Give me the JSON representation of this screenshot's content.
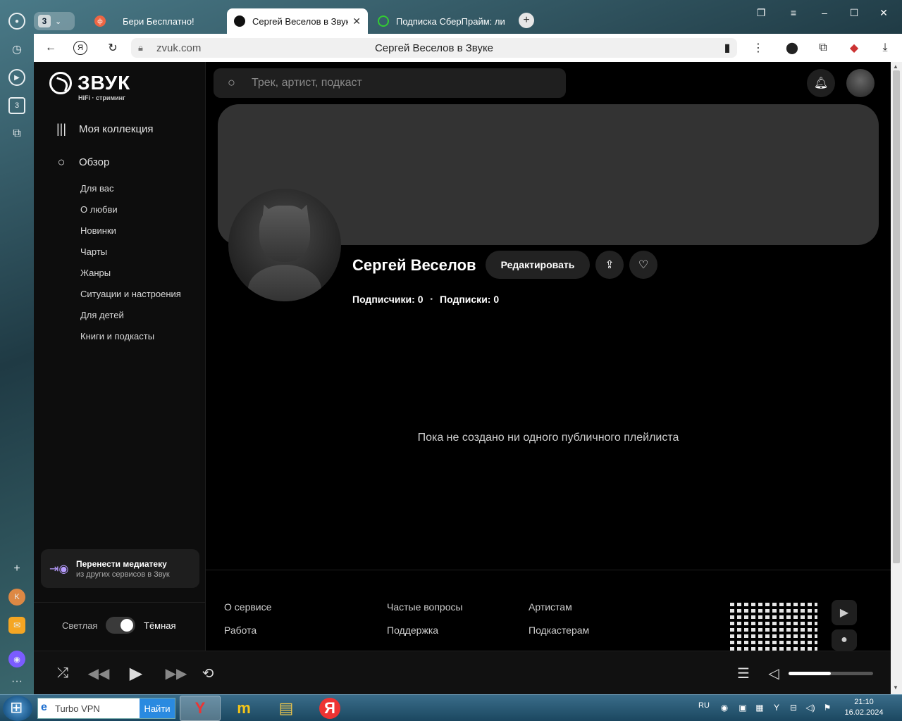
{
  "browser": {
    "tab_group_count": "3",
    "tabs": [
      {
        "title": "Бери Бесплатно!"
      },
      {
        "title": "Сергей Веселов в Звуке"
      },
      {
        "title": "Подписка СберПрайм: ли"
      }
    ],
    "url_host": "zvuk.com",
    "page_title": "Сергей Веселов в Звуке",
    "sidebar_badge": "3"
  },
  "app": {
    "logo_text": "ЗВУК",
    "logo_sub": "HiFi · стриминг",
    "nav_main": [
      {
        "label": "Моя коллекция"
      },
      {
        "label": "Обзор"
      }
    ],
    "nav_sub": [
      "Для вас",
      "О любви",
      "Новинки",
      "Чарты",
      "Жанры",
      "Ситуации и настроения",
      "Для детей",
      "Книги и подкасты"
    ],
    "transfer": {
      "title": "Перенести медиатеку",
      "subtitle": "из других сервисов в Звук"
    },
    "theme": {
      "light": "Светлая",
      "dark": "Тёмная",
      "dark_enabled": true
    },
    "search_placeholder": "Трек, артист, подкаст",
    "profile": {
      "name": "Сергей Веселов",
      "edit_label": "Редактировать",
      "followers": "Подписчики: 0",
      "following": "Подписки: 0"
    },
    "empty_message": "Пока не создано ни одного публичного плейлиста",
    "footer": {
      "col1": [
        "О сервисе",
        "Работа"
      ],
      "col2": [
        "Частые вопросы",
        "Поддержка"
      ],
      "col3": [
        "Артистам",
        "Подкастерам"
      ]
    },
    "player": {
      "volume_fraction": 0.5
    }
  },
  "taskbar": {
    "search_text": "Turbo VPN",
    "search_button": "Найти",
    "lang": "RU",
    "time": "21:10",
    "date": "16.02.2024"
  },
  "colors": {
    "accent_purple": "#b79cff",
    "background": "#000000"
  }
}
